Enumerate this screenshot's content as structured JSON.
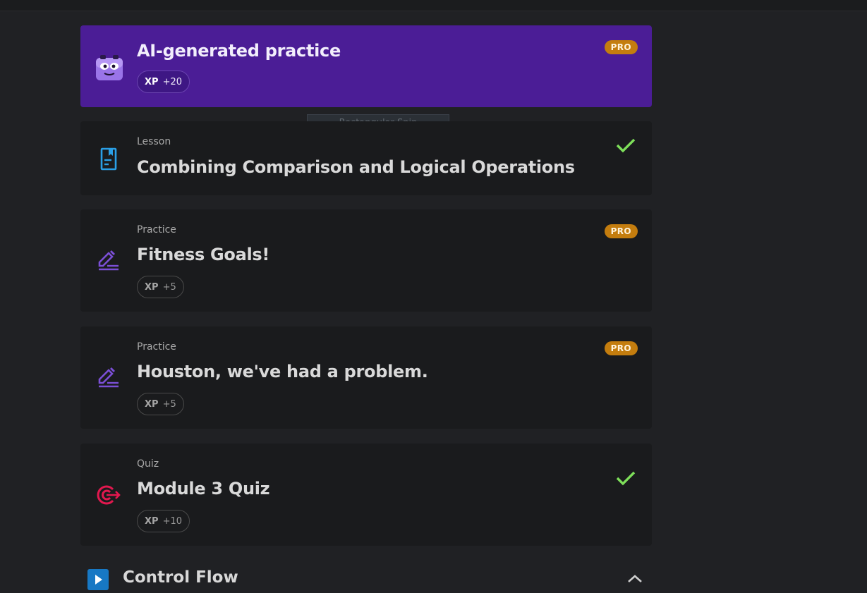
{
  "cards": [
    {
      "kind": "",
      "title": "AI-generated practice",
      "xp_label": "XP",
      "xp_value": "+20",
      "badge": "PRO",
      "icon": "robot-mascot-icon"
    },
    {
      "kind": "Lesson",
      "title": "Combining Comparison and Logical Operations",
      "completed": true,
      "icon": "document-bookmark-icon"
    },
    {
      "kind": "Practice",
      "title": "Fitness Goals!",
      "xp_label": "XP",
      "xp_value": "+5",
      "badge": "PRO",
      "icon": "pencil-lines-icon"
    },
    {
      "kind": "Practice",
      "title": "Houston, we've had a problem.",
      "xp_label": "XP",
      "xp_value": "+5",
      "badge": "PRO",
      "icon": "pencil-lines-icon"
    },
    {
      "kind": "Quiz",
      "title": "Module 3 Quiz",
      "xp_label": "XP",
      "xp_value": "+10",
      "completed": true,
      "icon": "target-icon"
    }
  ],
  "overlay": {
    "snip_tooltip": "Rectangular Snip"
  },
  "section": {
    "title": "Control Flow",
    "icon": "play-icon",
    "toggle": "chevron-up-icon"
  },
  "colors": {
    "ai_card": "#4b1d96",
    "pro_badge": "#c47d0e",
    "check": "#7ee05a",
    "quiz_icon": "#e3184f",
    "practice_icon": "#7b4fd6",
    "lesson_icon": "#2a9fe6"
  }
}
